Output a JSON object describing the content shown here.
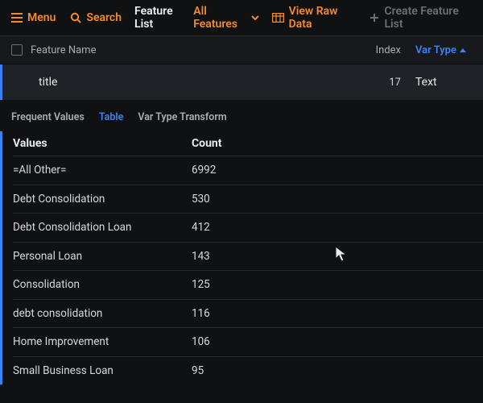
{
  "topbar": {
    "menu_label": "Menu",
    "search_label": "Search",
    "title_label": "Feature List",
    "feature_set_label": "All Features",
    "view_raw_label": "View Raw Data",
    "create_label": "Create Feature List"
  },
  "column_headers": {
    "feature_name": "Feature Name",
    "index": "Index",
    "var_type": "Var Type"
  },
  "selected_feature": {
    "name": "title",
    "index": "17",
    "var_type": "Text"
  },
  "subtabs": {
    "frequent_values": "Frequent Values",
    "table": "Table",
    "var_type_transform": "Var Type Transform"
  },
  "values_table": {
    "headers": {
      "values": "Values",
      "count": "Count"
    },
    "rows": [
      {
        "value": "=All Other=",
        "count": "6992"
      },
      {
        "value": "Debt Consolidation",
        "count": "530"
      },
      {
        "value": "Debt Consolidation Loan",
        "count": "412"
      },
      {
        "value": "Personal Loan",
        "count": "143"
      },
      {
        "value": "Consolidation",
        "count": "125"
      },
      {
        "value": "debt consolidation",
        "count": "116"
      },
      {
        "value": "Home Improvement",
        "count": "106"
      },
      {
        "value": "Small Business Loan",
        "count": "95"
      }
    ]
  }
}
